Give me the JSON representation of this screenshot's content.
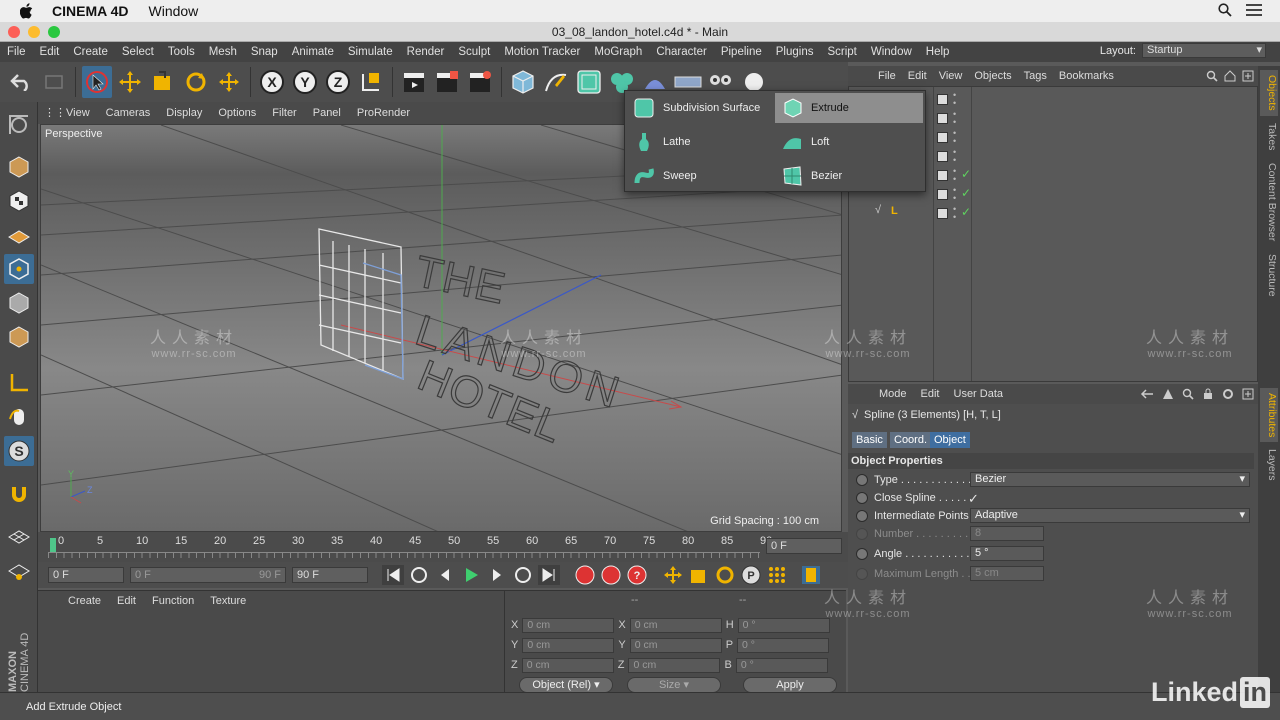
{
  "mac_menubar": {
    "app_name": "CINEMA 4D",
    "menu": "Window"
  },
  "window": {
    "title": "03_08_landon_hotel.c4d * - Main"
  },
  "main_menu": [
    "File",
    "Edit",
    "Create",
    "Select",
    "Tools",
    "Mesh",
    "Snap",
    "Animate",
    "Simulate",
    "Render",
    "Sculpt",
    "Motion Tracker",
    "MoGraph",
    "Character",
    "Pipeline",
    "Plugins",
    "Script",
    "Window",
    "Help"
  ],
  "layout": {
    "label": "Layout:",
    "value": "Startup"
  },
  "toolbar": {
    "undo_icon": "undo-icon",
    "redo_icon": "redo-icon",
    "axis_x": "X",
    "axis_y": "Y",
    "axis_z": "Z"
  },
  "viewport": {
    "menu": [
      "View",
      "Cameras",
      "Display",
      "Options",
      "Filter",
      "Panel",
      "ProRender"
    ],
    "label": "Perspective",
    "grid_spacing": "Grid Spacing : 100 cm",
    "text_lines": [
      "THE",
      "LANDON",
      "HOTEL"
    ],
    "axis_labels": {
      "y": "Y",
      "z": "Z"
    }
  },
  "timeline": {
    "ticks": [
      "0",
      "5",
      "10",
      "15",
      "20",
      "25",
      "30",
      "35",
      "40",
      "45",
      "50",
      "55",
      "60",
      "65",
      "70",
      "75",
      "80",
      "85",
      "90"
    ],
    "current_frame": "0 F",
    "start_field": "0 F",
    "range_start": "0 F",
    "range_end": "90 F",
    "end_field": "90 F"
  },
  "material_menu": [
    "Create",
    "Edit",
    "Function",
    "Texture"
  ],
  "coordinates": {
    "header_dashes": [
      "--",
      "--"
    ],
    "rows": [
      {
        "l1": "X",
        "v1": "0 cm",
        "l2": "X",
        "v2": "0 cm",
        "l3": "H",
        "v3": "0 °"
      },
      {
        "l1": "Y",
        "v1": "0 cm",
        "l2": "Y",
        "v2": "0 cm",
        "l3": "P",
        "v3": "0 °"
      },
      {
        "l1": "Z",
        "v1": "0 cm",
        "l2": "Z",
        "v2": "0 cm",
        "l3": "B",
        "v3": "0 °"
      }
    ],
    "mode_dropdown": "Object (Rel)",
    "size_dropdown": "Size",
    "apply_button": "Apply"
  },
  "status": "Add Extrude Object",
  "objects_menu": [
    "File",
    "Edit",
    "View",
    "Objects",
    "Tags",
    "Bookmarks"
  ],
  "objects_tree": {
    "last_item": "L"
  },
  "attributes": {
    "menu": [
      "Mode",
      "Edit",
      "User Data"
    ],
    "object_title": "Spline (3 Elements) [H, T, L]",
    "tabs": [
      "Basic",
      "Coord.",
      "Object"
    ],
    "section": "Object Properties",
    "rows": [
      {
        "label": "Type . . . . . . . . . . . .",
        "value": "Bezier"
      },
      {
        "label": "Close Spline . . . . . .",
        "value": "✓"
      },
      {
        "label": "Intermediate Points",
        "value": "Adaptive"
      },
      {
        "label": "Number . . . . . . . . .",
        "value": "8"
      },
      {
        "label": "Angle . . . . . . . . . . .",
        "value": "5 °"
      },
      {
        "label": "Maximum Length . .",
        "value": "5 cm"
      }
    ]
  },
  "side_tabs": [
    "Objects",
    "Takes",
    "Content Browser",
    "Structure"
  ],
  "side_tabs_lower": [
    "Attributes",
    "Layers"
  ],
  "popup": {
    "items": [
      {
        "label": "Subdivision Surface",
        "icon": "subdivision-surface-icon"
      },
      {
        "label": "Extrude",
        "icon": "extrude-icon",
        "highlighted": true
      },
      {
        "label": "Lathe",
        "icon": "lathe-icon"
      },
      {
        "label": "Loft",
        "icon": "loft-icon"
      },
      {
        "label": "Sweep",
        "icon": "sweep-icon"
      },
      {
        "label": "Bezier",
        "icon": "bezier-icon"
      }
    ]
  },
  "maxon_logo": "MAXON CINEMA 4D",
  "watermark": {
    "cn": "人人素材",
    "url": "www.rr-sc.com"
  },
  "linkedin": {
    "text": "Linked",
    "in": "in"
  }
}
